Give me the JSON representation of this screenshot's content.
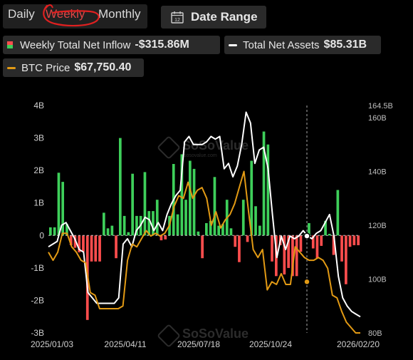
{
  "tabs": {
    "daily": "Daily",
    "weekly": "Weekly",
    "monthly": "Monthly",
    "selected": "Weekly"
  },
  "date_range": {
    "label": "Date Range",
    "icon": "calendar-icon",
    "icon_text": "12"
  },
  "legend": {
    "inflow": {
      "label": "Weekly Total Net Inflow",
      "value": "-$315.86M",
      "colors": [
        "#ff4d4d",
        "#3ecf5a"
      ]
    },
    "assets": {
      "label": "Total Net Assets",
      "value": "$85.31B",
      "color": "#ffffff"
    },
    "btc": {
      "label": "BTC Price",
      "value": "$67,750.40",
      "color": "#e29a14"
    }
  },
  "watermark": {
    "text": "SoSoValue",
    "sub": "sosovalue.com"
  },
  "chart_data": {
    "type": "bar+line",
    "x_labels": [
      "2025/01/03",
      "2025/04/11",
      "2025/07/18",
      "2025/10/24",
      "2026/02/20"
    ],
    "y_left": {
      "ticks": [
        "4B",
        "3B",
        "2B",
        "1B",
        "0",
        "-1B",
        "-2B",
        "-3B"
      ],
      "range": [
        -3,
        4
      ],
      "unit": "B"
    },
    "y_right": {
      "ticks": [
        "164.5B",
        "160B",
        "140B",
        "120B",
        "100B",
        "80B"
      ],
      "range": [
        80,
        164.5
      ],
      "unit": "B"
    },
    "series": [
      {
        "name": "Weekly Total Net Inflow",
        "type": "bar",
        "unit": "B",
        "positive_color": "#3ecf5a",
        "negative_color": "#ff4d4d",
        "values": [
          0.25,
          0.25,
          1.93,
          1.65,
          0.35,
          -0.3,
          -0.38,
          -0.52,
          -0.5,
          -2.6,
          -0.8,
          -0.8,
          -0.8,
          0.7,
          0.22,
          0.3,
          -0.7,
          3.0,
          0.6,
          0.1,
          1.9,
          0.6,
          0.6,
          1.95,
          0.75,
          0.75,
          1.1,
          -0.15,
          -0.12,
          0.6,
          2.2,
          0.65,
          2.5,
          1.1,
          2.3,
          2.05,
          0.12,
          -0.7,
          0.38,
          0.45,
          1.8,
          0.3,
          0.35,
          1.1,
          0.22,
          -0.35,
          -0.82,
          1.1,
          -0.2,
          2.3,
          0.9,
          0.3,
          3.2,
          2.8,
          -0.8,
          -1.25,
          -0.3,
          -1.2,
          -1.0,
          -1.25,
          -1.25,
          -0.5,
          0.05,
          0.38,
          -0.4,
          -0.7,
          -0.32,
          0.45,
          0.05,
          -0.6,
          1.4,
          -0.8,
          -1.5,
          -0.35,
          -0.3,
          -0.3
        ]
      },
      {
        "name": "Total Net Assets",
        "type": "line",
        "color": "#ffffff",
        "unit": "B",
        "values": [
          112,
          113,
          114,
          120,
          121,
          118,
          115,
          111,
          110,
          95,
          93,
          91,
          91,
          91,
          91,
          91,
          93,
          113,
          115,
          112,
          118,
          120,
          123,
          122,
          118,
          121,
          118,
          124,
          128,
          131,
          133,
          151,
          153,
          150,
          150,
          150,
          151,
          153,
          152,
          153,
          141,
          143,
          138,
          142,
          150,
          162,
          158,
          143,
          148,
          149,
          141,
          124,
          108,
          116,
          111,
          116,
          115,
          116,
          118,
          116,
          115,
          117,
          118,
          121,
          124,
          116,
          101,
          93,
          90,
          88,
          87,
          86
        ]
      },
      {
        "name": "BTC Price",
        "type": "line",
        "color": "#e29a14",
        "unit": "B",
        "values": [
          110,
          107,
          110,
          117,
          117,
          112,
          110,
          107,
          106,
          95,
          94,
          89,
          89,
          89,
          89,
          89,
          90,
          107,
          113,
          112,
          115,
          118,
          116,
          117,
          116,
          117,
          120,
          127,
          131,
          130,
          136,
          130,
          133,
          134,
          130,
          120,
          125,
          119,
          122,
          124,
          128,
          134,
          140,
          125,
          111,
          108,
          111,
          96,
          99,
          98,
          102,
          98,
          98,
          112,
          110,
          108,
          107,
          107,
          108,
          107,
          104,
          94,
          93,
          88,
          84,
          82,
          80,
          80
        ]
      }
    ],
    "markers": [
      {
        "series": "Total Net Assets",
        "value": 116
      },
      {
        "series": "BTC Price",
        "value": 99
      }
    ],
    "zero_line": "dashed",
    "crosshair": "vertical dashed",
    "grid": false
  }
}
